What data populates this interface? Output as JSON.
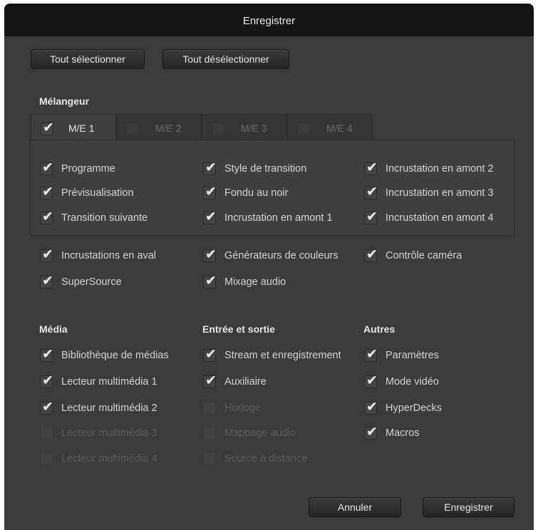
{
  "dialog": {
    "title": "Enregistrer",
    "select_all": "Tout sélectionner",
    "deselect_all": "Tout désélectionner",
    "cancel": "Annuler",
    "save": "Enregistrer"
  },
  "mixer": {
    "heading": "Mélangeur",
    "tabs": [
      {
        "label": "M/E 1",
        "checked": true
      },
      {
        "label": "M/E 2",
        "checked": false
      },
      {
        "label": "M/E 3",
        "checked": false
      },
      {
        "label": "M/E 4",
        "checked": false
      }
    ],
    "panel_items": [
      {
        "label": "Programme",
        "checked": true
      },
      {
        "label": "Prévisualisation",
        "checked": true
      },
      {
        "label": "Transition suivante",
        "checked": true
      },
      {
        "label": "Style de transition",
        "checked": true
      },
      {
        "label": "Fondu au noir",
        "checked": true
      },
      {
        "label": "Incrustation en amont 1",
        "checked": true
      },
      {
        "label": "Incrustation en amont 2",
        "checked": true
      },
      {
        "label": "Incrustation en amont 3",
        "checked": true
      },
      {
        "label": "Incrustation en amont 4",
        "checked": true
      }
    ],
    "other_items": [
      {
        "label": "Incrustations en aval",
        "checked": true
      },
      {
        "label": "SuperSource",
        "checked": true
      },
      {
        "label": "Générateurs de couleurs",
        "checked": true
      },
      {
        "label": "Mixage audio",
        "checked": true
      },
      {
        "label": "Contrôle caméra",
        "checked": true
      }
    ]
  },
  "media": {
    "heading": "Média",
    "items": [
      {
        "label": "Bibliothèque de médias",
        "checked": true,
        "enabled": true
      },
      {
        "label": "Lecteur multimédia 1",
        "checked": true,
        "enabled": true
      },
      {
        "label": "Lecteur multimédia 2",
        "checked": true,
        "enabled": true
      },
      {
        "label": "Lecteur multimédia 3",
        "checked": false,
        "enabled": false
      },
      {
        "label": "Lecteur multimédia 4",
        "checked": false,
        "enabled": false
      }
    ]
  },
  "io": {
    "heading": "Entrée et sortie",
    "items": [
      {
        "label": "Stream et enregistrement",
        "checked": true,
        "enabled": true
      },
      {
        "label": "Auxiliaire",
        "checked": true,
        "enabled": true
      },
      {
        "label": "Horloge",
        "checked": false,
        "enabled": false
      },
      {
        "label": "Mappage audio",
        "checked": false,
        "enabled": false
      },
      {
        "label": "Source à distance",
        "checked": false,
        "enabled": false
      }
    ]
  },
  "others": {
    "heading": "Autres",
    "items": [
      {
        "label": "Paramètres",
        "checked": true,
        "enabled": true
      },
      {
        "label": "Mode vidéo",
        "checked": true,
        "enabled": true
      },
      {
        "label": "HyperDecks",
        "checked": true,
        "enabled": true
      },
      {
        "label": "Macros",
        "checked": true,
        "enabled": true
      }
    ]
  },
  "icons": {
    "check": "checkmark-icon"
  }
}
